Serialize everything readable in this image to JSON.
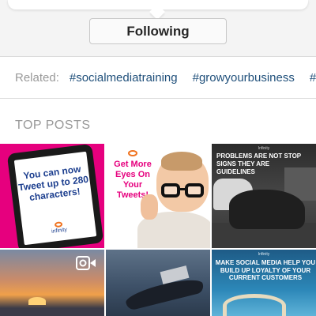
{
  "header": {
    "follow_button_label": "Following"
  },
  "related": {
    "label": "Related:",
    "tags": [
      "#socialmediatraining",
      "#growyourbusiness",
      "#"
    ]
  },
  "top_posts": {
    "title": "TOP POSTS",
    "posts": [
      {
        "type": "image",
        "text": "You can now Tweet up to 280 characters!",
        "brand": "infinity"
      },
      {
        "type": "image",
        "text": "Get More Eyes On Your Tweets!"
      },
      {
        "type": "image",
        "logo": "Infinity",
        "text": "PROBLEMS ARE NOT STOP SIGNS THEY ARE GUIDELINES"
      },
      {
        "type": "video",
        "icon": "video-icon"
      },
      {
        "type": "image"
      },
      {
        "type": "image",
        "logo": "Infinity",
        "text": "MAKE SOCIAL MEDIA HELP YOU BUILD UP LOYALTY OF YOUR CURRENT CUSTOMERS"
      }
    ]
  }
}
